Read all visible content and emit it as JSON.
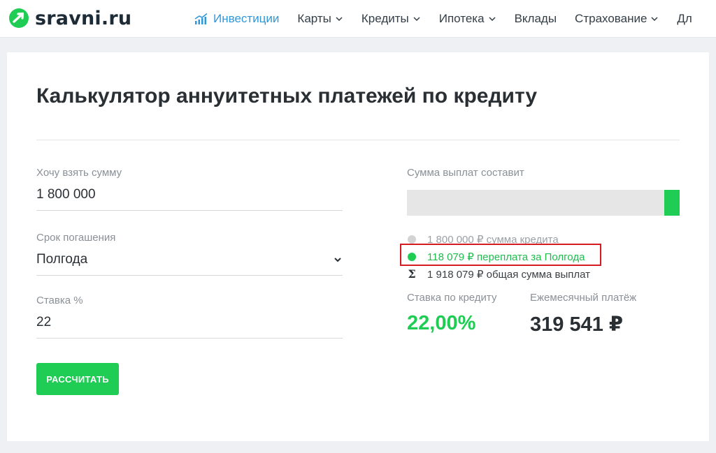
{
  "header": {
    "logo_text": "sravni.ru",
    "nav": [
      {
        "label": "Инвестиции",
        "active": true,
        "has_dropdown": false,
        "icon": "chart-icon"
      },
      {
        "label": "Карты",
        "has_dropdown": true
      },
      {
        "label": "Кредиты",
        "has_dropdown": true
      },
      {
        "label": "Ипотека",
        "has_dropdown": true
      },
      {
        "label": "Вклады",
        "has_dropdown": false
      },
      {
        "label": "Страхование",
        "has_dropdown": true
      },
      {
        "label": "Дл",
        "has_dropdown": false
      }
    ]
  },
  "calculator": {
    "title": "Калькулятор аннуитетных платежей по кредиту",
    "amount": {
      "label": "Хочу взять сумму",
      "value": "1 800 000"
    },
    "term": {
      "label": "Срок погашения",
      "value": "Полгода"
    },
    "rate": {
      "label": "Ставка %",
      "value": "22"
    },
    "button_label": "РАССЧИТАТЬ"
  },
  "results": {
    "label": "Сумма выплат составит",
    "bar": {
      "principal_share": 0.9385,
      "overpay_share": 0.0615
    },
    "legend": [
      {
        "icon": "grey-dot-icon",
        "text": "1 800 000 ₽ сумма кредита"
      },
      {
        "icon": "green-dot-icon",
        "text": "118 079 ₽ переплата за Полгода"
      },
      {
        "icon": "sigma-icon",
        "text": "1 918 079 ₽ общая сумма выплат"
      }
    ],
    "rate_label": "Ставка по кредиту",
    "rate_value": "22,00%",
    "payment_label": "Ежемесячный платёж",
    "payment_value": "319 541 ₽"
  },
  "colors": {
    "accent_green": "#1fcc54",
    "nav_active": "#2e98d8",
    "highlight_red": "#d41a23"
  }
}
